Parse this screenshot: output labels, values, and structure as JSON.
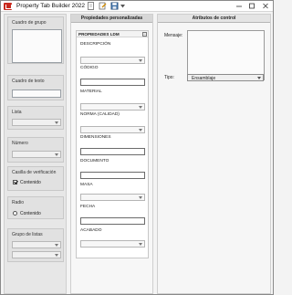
{
  "window": {
    "title": "Property Tab Builder  2022"
  },
  "toolbox": {
    "group_box": {
      "label": "Cuadro de grupo"
    },
    "text_box": {
      "label": "Cuadro de texto"
    },
    "list": {
      "label": "Lista"
    },
    "number": {
      "label": "Número"
    },
    "checkbox": {
      "label": "Casilla de verificación",
      "option": "Contenido",
      "checked": true
    },
    "radio": {
      "label": "Radio",
      "option": "Contenido",
      "selected": false
    },
    "list_group": {
      "label": "Grupo de listas"
    }
  },
  "properties_panel": {
    "header": "Propiedades personalizadas",
    "group_title": "PROPIEDADES LDM",
    "fields": {
      "descripcion": "DESCRIPCIÓN",
      "codigo": "CÓDIGO",
      "material": "MATERIAL",
      "norma": "NORMA (CALIDAD)",
      "dimensiones": "DIMENSIONES",
      "documento": "DOCUMENTO",
      "masa": "MASA",
      "fecha": "FECHA",
      "acabado": "ACABADO"
    }
  },
  "attributes_panel": {
    "header": "Atributos de control",
    "message_label": "Mensaje:",
    "type_label": "Tipo:",
    "type_value": "Ensamblaje"
  },
  "icons": [
    "app-logo-icon",
    "new-document-icon",
    "open-edit-icon",
    "save-icon",
    "dropdown-arrow-icon",
    "minimize-icon",
    "maximize-icon",
    "close-icon",
    "collapse-icon",
    "checkmark-icon"
  ],
  "colors": {
    "app_icon": "#c8291e",
    "header_gray": "#d7d7d7",
    "panel_bg": "#f6f6f6"
  }
}
